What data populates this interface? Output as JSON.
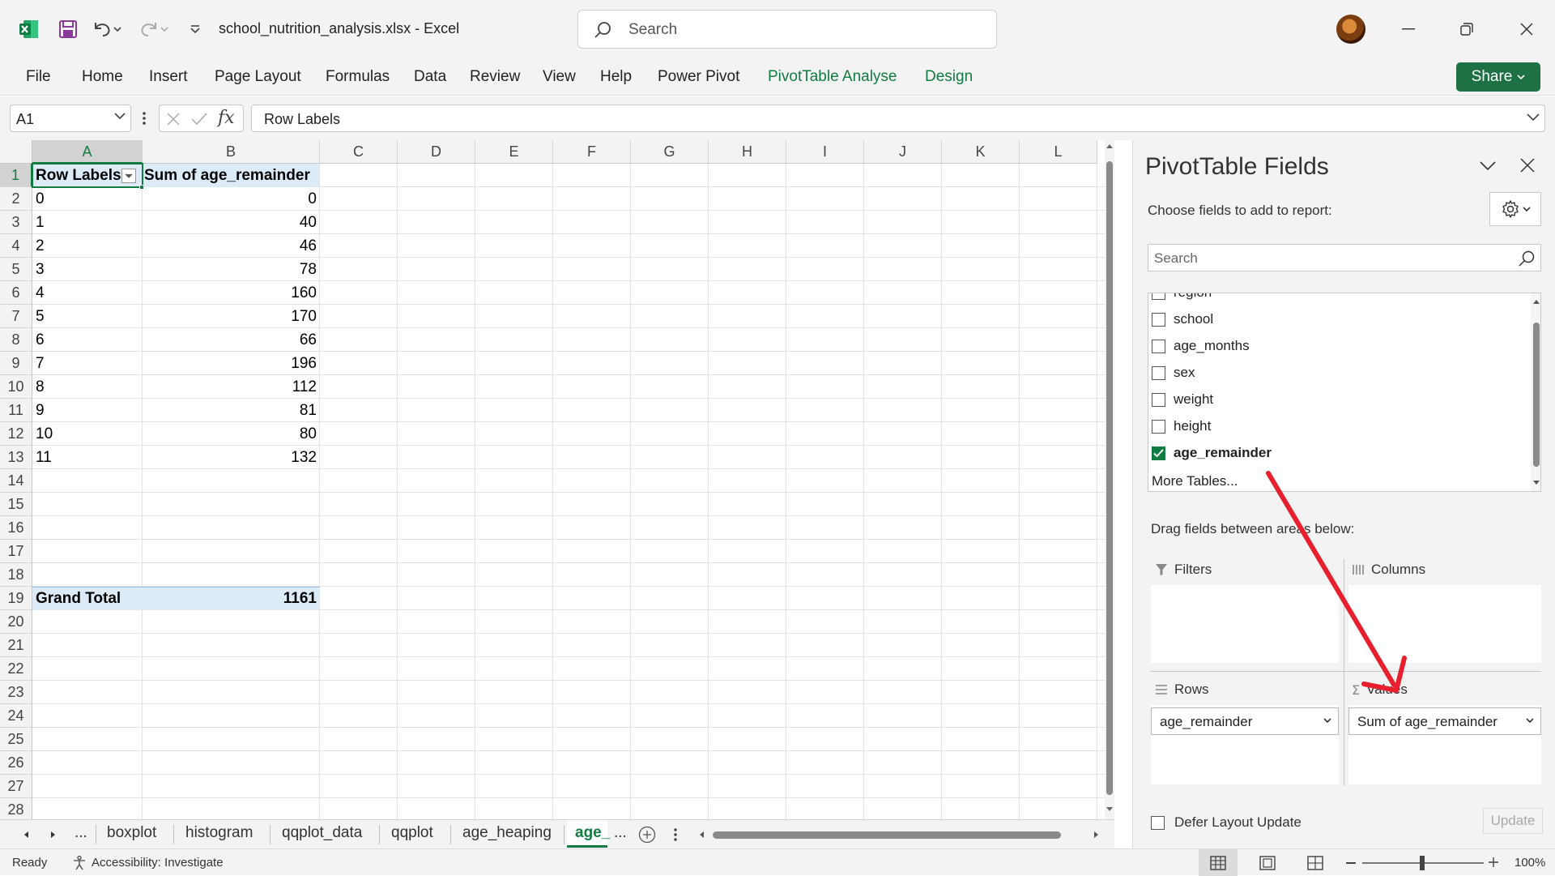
{
  "window": {
    "doc_title": "school_nutrition_analysis.xlsx  -  Excel",
    "search_placeholder": "Search"
  },
  "ribbon": {
    "tabs": [
      "File",
      "Home",
      "Insert",
      "Page Layout",
      "Formulas",
      "Data",
      "Review",
      "View",
      "Help",
      "Power Pivot",
      "PivotTable Analyse",
      "Design"
    ],
    "share_label": "Share"
  },
  "formula_bar": {
    "name_box": "A1",
    "formula": "Row Labels"
  },
  "grid": {
    "columns": [
      "A",
      "B",
      "C",
      "D",
      "E",
      "F",
      "G",
      "H",
      "I",
      "J",
      "K",
      "L"
    ],
    "rows": [
      "1",
      "2",
      "3",
      "4",
      "5",
      "6",
      "7",
      "8",
      "9",
      "10",
      "11",
      "12",
      "13",
      "14",
      "15",
      "16",
      "17",
      "18",
      "19",
      "20",
      "21",
      "22",
      "23",
      "24",
      "25",
      "26",
      "27",
      "28"
    ],
    "pivot_header": {
      "row_labels": "Row Labels",
      "value_header": "Sum of age_remainder"
    },
    "pivot_rows": [
      {
        "label": "0",
        "value": "0"
      },
      {
        "label": "1",
        "value": "40"
      },
      {
        "label": "2",
        "value": "46"
      },
      {
        "label": "3",
        "value": "78"
      },
      {
        "label": "4",
        "value": "160"
      },
      {
        "label": "5",
        "value": "170"
      },
      {
        "label": "6",
        "value": "66"
      },
      {
        "label": "7",
        "value": "196"
      },
      {
        "label": "8",
        "value": "112"
      },
      {
        "label": "9",
        "value": "81"
      },
      {
        "label": "10",
        "value": "80"
      },
      {
        "label": "11",
        "value": "132"
      }
    ],
    "grand_total": {
      "label": "Grand Total",
      "value": "1161"
    }
  },
  "sheet_tabs": {
    "ellipsis_left": "...",
    "tabs": [
      "boxplot",
      "histogram",
      "qqplot_data",
      "qqplot",
      "age_heaping"
    ],
    "active": "age_",
    "ellipsis_right": "..."
  },
  "status_bar": {
    "ready": "Ready",
    "accessibility": "Accessibility: Investigate",
    "zoom": "100%"
  },
  "pivot_pane": {
    "title": "PivotTable Fields",
    "subtitle": "Choose fields to add to report:",
    "search_placeholder": "Search",
    "fields": [
      {
        "name": "region",
        "checked": false
      },
      {
        "name": "school",
        "checked": false
      },
      {
        "name": "age_months",
        "checked": false
      },
      {
        "name": "sex",
        "checked": false
      },
      {
        "name": "weight",
        "checked": false
      },
      {
        "name": "height",
        "checked": false
      },
      {
        "name": "age_remainder",
        "checked": true
      }
    ],
    "more_tables": "More Tables...",
    "drag_label": "Drag fields between areas below:",
    "areas": {
      "filters": "Filters",
      "columns": "Columns",
      "rows": "Rows",
      "values": "Values",
      "rows_item": "age_remainder",
      "values_item": "Sum of age_remainder"
    },
    "defer_label": "Defer Layout Update",
    "update_label": "Update"
  },
  "colors": {
    "excel_green": "#107c41",
    "share_green": "#1e7145",
    "pivot_header_blue": "#ddebf7",
    "annotation_red": "#e8202e"
  }
}
